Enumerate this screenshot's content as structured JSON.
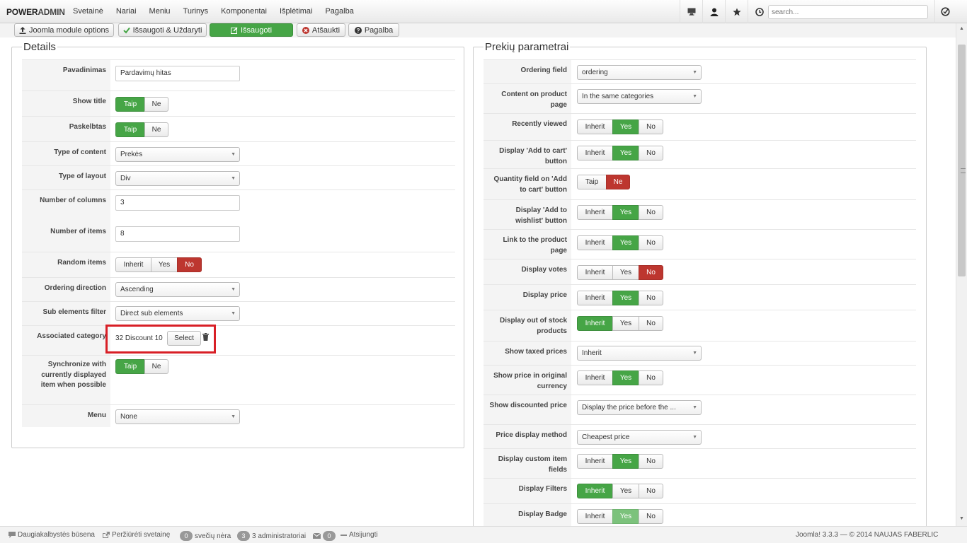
{
  "brand": {
    "part1": "POWER",
    "part2": "ADMIN"
  },
  "menu": [
    "Svetainė",
    "Nariai",
    "Meniu",
    "Turinys",
    "Komponentai",
    "Išplėtimai",
    "Pagalba"
  ],
  "search": {
    "placeholder": "search..."
  },
  "toolbar": {
    "module_options": "Joomla module options",
    "save_close": "Išsaugoti & Uždaryti",
    "save": "Išsaugoti",
    "cancel": "Atšaukti",
    "help": "Pagalba"
  },
  "left": {
    "legend": "Details",
    "name_label": "Pavadinimas",
    "name_value": "Pardavimų hitas",
    "show_title_label": "Show title",
    "published_label": "Paskelbtas",
    "content_type_label": "Type of content",
    "content_type_value": "Prekės",
    "layout_type_label": "Type of layout",
    "layout_type_value": "Div",
    "columns_label": "Number of columns",
    "columns_value": "3",
    "items_label": "Number of items",
    "items_value": "8",
    "random_label": "Random items",
    "ordering_dir_label": "Ordering direction",
    "ordering_dir_value": "Ascending",
    "sub_filter_label": "Sub elements filter",
    "sub_filter_value": "Direct sub elements",
    "assoc_cat_label": "Associated category",
    "assoc_cat_value": "32 Discount 10",
    "select_btn": "Select",
    "sync_label": "Synchronize with currently displayed item when possible",
    "menu_label": "Menu",
    "menu_value": "None"
  },
  "taip_ne": {
    "yes": "Taip",
    "no": "Ne"
  },
  "ternary": {
    "inherit": "Inherit",
    "yes": "Yes",
    "no": "No"
  },
  "right": {
    "legend": "Prekių parametrai",
    "ordering_field_label": "Ordering field",
    "ordering_field_value": "ordering",
    "content_on_product_label": "Content on product page",
    "content_on_product_value": "In the same categories",
    "recently_viewed_label": "Recently viewed",
    "add_to_cart_label": "Display 'Add to cart' button",
    "qty_field_label": "Quantity field on 'Add to cart' button",
    "wishlist_label": "Display 'Add to wishlist' button",
    "link_product_label": "Link to the product page",
    "votes_label": "Display votes",
    "price_label": "Display price",
    "out_of_stock_label": "Display out of stock products",
    "taxed_label": "Show taxed prices",
    "taxed_value": "Inherit",
    "orig_currency_label": "Show price in original currency",
    "discounted_label": "Show discounted price",
    "discounted_value": "Display the price before the ...",
    "price_method_label": "Price display method",
    "price_method_value": "Cheapest price",
    "custom_fields_label": "Display custom item fields",
    "filters_label": "Display Filters",
    "badge_label": "Display Badge"
  },
  "status": {
    "multilang": "Daugiakalbystės būsena",
    "view_site": "Peržiūrėti svetainę",
    "guests_count": "0",
    "guests": "svečių nėra",
    "admins_count": "3",
    "admins": "3 administratoriai",
    "msg_count": "0",
    "logout": "Atsijungti",
    "version": "Joomla! 3.3.3 — © 2014 NAUJAS FABERLIC"
  }
}
